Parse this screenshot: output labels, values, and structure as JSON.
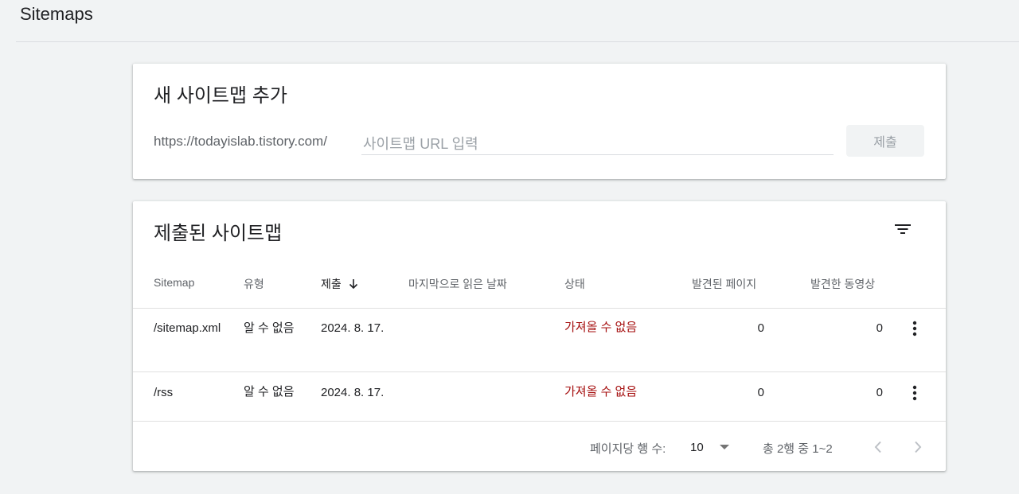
{
  "header": {
    "title": "Sitemaps"
  },
  "add_card": {
    "title": "새 사이트맵 추가",
    "url_prefix": "https://todayislab.tistory.com/",
    "input_placeholder": "사이트맵 URL 입력",
    "input_value": "",
    "submit_label": "제출"
  },
  "list_card": {
    "title": "제출된 사이트맵",
    "columns": [
      "Sitemap",
      "유형",
      "제출",
      "마지막으로 읽은 날짜",
      "상태",
      "발견된 페이지",
      "발견한 동영상"
    ],
    "sort_column": "제출",
    "rows": [
      {
        "sitemap": "/sitemap.xml",
        "type": "알 수 없음",
        "submitted": "2024. 8. 17.",
        "last_read": "",
        "status": "가져올 수 없음",
        "pages": "0",
        "videos": "0"
      },
      {
        "sitemap": "/rss",
        "type": "알 수 없음",
        "submitted": "2024. 8. 17.",
        "last_read": "",
        "status": "가져올 수 없음",
        "pages": "0",
        "videos": "0"
      }
    ],
    "pagination": {
      "rows_per_page_label": "페이지당 행 수:",
      "rows_per_page_value": "10",
      "range_text": "총 2행 중 1~2"
    }
  },
  "icons": {
    "filter": "filter-icon",
    "sort": "arrow-down-icon",
    "more": "more-vert-icon",
    "prev": "chevron-left-icon",
    "next": "chevron-right-icon",
    "dropdown": "caret-down-icon"
  },
  "colors": {
    "status_error": "#a50e0e",
    "background": "#f1f3f4"
  }
}
